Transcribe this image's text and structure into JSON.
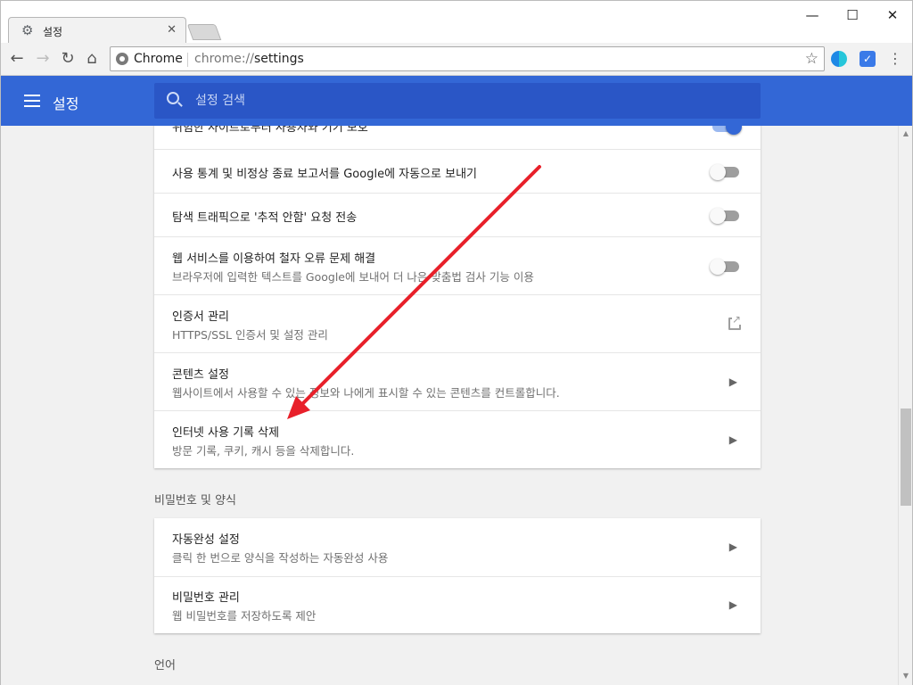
{
  "window": {
    "tab_title": "설정",
    "tab_close": "✕",
    "minimize": "—",
    "maximize": "☐",
    "close": "✕"
  },
  "toolbar": {
    "back": "←",
    "forward": "→",
    "reload": "↻",
    "home": "⌂",
    "site_chip": "Chrome",
    "url_scheme": "chrome://",
    "url_path": "settings",
    "bookmark_star": "☆",
    "menu": "⋮"
  },
  "header": {
    "title": "설정",
    "search_placeholder": "설정 검색"
  },
  "privacy_card": {
    "rows": [
      {
        "label": "위험한 사이트로부터 사용자와 기기 보호",
        "control": "toggle",
        "state": "on"
      },
      {
        "label": "사용 통계 및 비정상 종료 보고서를 Google에 자동으로 보내기",
        "control": "toggle",
        "state": "off"
      },
      {
        "label": "탐색 트래픽으로 '추적 안함' 요청 전송",
        "control": "toggle",
        "state": "off"
      },
      {
        "label": "웹 서비스를 이용하여 철자 오류 문제 해결",
        "sub": "브라우저에 입력한 텍스트를 Google에 보내어 더 나은 맞춤법 검사 기능 이용",
        "control": "toggle",
        "state": "off"
      },
      {
        "label": "인증서 관리",
        "sub": "HTTPS/SSL 인증서 및 설정 관리",
        "control": "external-link"
      },
      {
        "label": "콘텐츠 설정",
        "sub": "웹사이트에서 사용할 수 있는 정보와 나에게 표시할 수 있는 콘텐츠를 컨트롤합니다.",
        "control": "chevron"
      },
      {
        "label": "인터넷 사용 기록 삭제",
        "sub": "방문 기록, 쿠키, 캐시 등을 삭제합니다.",
        "control": "chevron"
      }
    ]
  },
  "passwords_section": {
    "title": "비밀번호 및 양식",
    "rows": [
      {
        "label": "자동완성 설정",
        "sub": "클릭 한 번으로 양식을 작성하는 자동완성 사용",
        "control": "chevron"
      },
      {
        "label": "비밀번호 관리",
        "sub": "웹 비밀번호를 저장하도록 제안",
        "control": "chevron"
      }
    ]
  },
  "language_section": {
    "title": "언어"
  },
  "chevron_glyph": "▶",
  "colors": {
    "header_blue": "#3367d6",
    "search_blue": "#2a56c6",
    "annotation_red": "#e8202a"
  }
}
